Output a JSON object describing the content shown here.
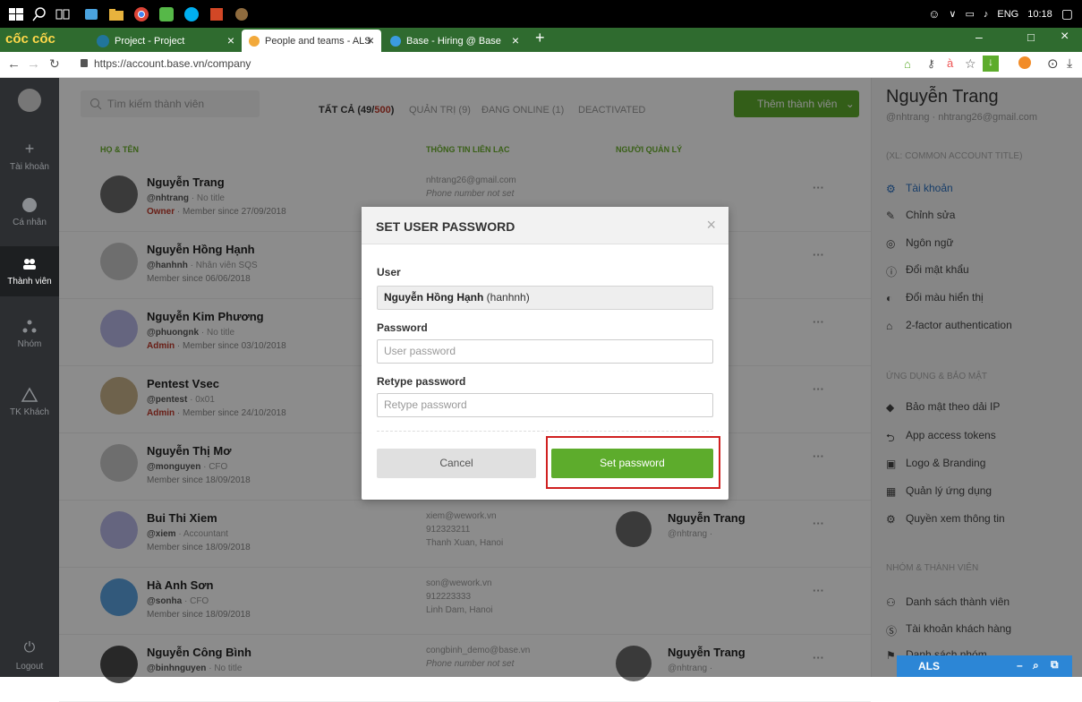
{
  "taskbar": {
    "language": "ENG",
    "time": "10:18"
  },
  "browser": {
    "brand": "cốc cốc",
    "tabs": [
      {
        "label": "Project - Project",
        "active": false
      },
      {
        "label": "People and teams - ALS",
        "active": true
      },
      {
        "label": "Base - Hiring @ Base",
        "active": false
      }
    ],
    "url": "https://account.base.vn/company"
  },
  "leftnav": {
    "items": [
      {
        "label": "Tài khoản",
        "active": false
      },
      {
        "label": "Cá nhân",
        "active": false
      },
      {
        "label": "Thành viên",
        "active": true
      },
      {
        "label": "Nhóm",
        "active": false
      },
      {
        "label": "TK Khách",
        "active": false
      }
    ],
    "logout": "Logout"
  },
  "main": {
    "search_placeholder": "Tìm kiếm thành viên",
    "filters": {
      "all_prefix": "TẤT CẢ (49/",
      "all_limit": "500",
      "all_suffix": ")",
      "admins": "QUẢN TRỊ (9)",
      "online": "ĐANG ONLINE (1)",
      "deactivated": "DEACTIVATED"
    },
    "add_button": "Thêm thành viên",
    "columns": {
      "name": "HỌ & TÊN",
      "contact": "THÔNG TIN LIÊN LẠC",
      "manager": "NGƯỜI QUẢN LÝ"
    },
    "rows": [
      {
        "name": "Nguyễn Trang",
        "handle": "@nhtrang",
        "title": "No title",
        "role": "Owner",
        "since": "Member since 27/09/2018",
        "contact1": "nhtrang26@gmail.com",
        "contact2": "Phone number not set",
        "contact3": "",
        "manager": "",
        "manager_handle": ""
      },
      {
        "name": "Nguyễn Hồng Hạnh",
        "handle": "@hanhnh",
        "title": "Nhân viên SQS",
        "role": "",
        "since": "Member since 06/06/2018",
        "contact1": "",
        "contact2": "",
        "contact3": "",
        "manager": "",
        "manager_handle": ""
      },
      {
        "name": "Nguyễn Kim Phương",
        "handle": "@phuongnk",
        "title": "No title",
        "role": "Admin",
        "since": "Member since 03/10/2018",
        "contact1": "",
        "contact2": "",
        "contact3": "",
        "manager": "",
        "manager_handle": ""
      },
      {
        "name": "Pentest Vsec",
        "handle": "@pentest",
        "title": "0x01",
        "role": "Admin",
        "since": "Member since 24/10/2018",
        "contact1": "",
        "contact2": "",
        "contact3": "",
        "manager": "",
        "manager_handle": ""
      },
      {
        "name": "Nguyễn Thị Mơ",
        "handle": "@monguyen",
        "title": "CFO",
        "role": "",
        "since": "Member since 18/09/2018",
        "contact1": "",
        "contact2": "",
        "contact3": "",
        "manager": "",
        "manager_handle": ""
      },
      {
        "name": "Bui Thi Xiem",
        "handle": "@xiem",
        "title": "Accountant",
        "role": "",
        "since": "Member since 18/09/2018",
        "contact1": "xiem@wework.vn",
        "contact2": "912323211",
        "contact3": "Thanh Xuan, Hanoi",
        "manager": "Nguyễn Trang",
        "manager_handle": "@nhtrang ·"
      },
      {
        "name": "Hà Anh Sơn",
        "handle": "@sonha",
        "title": "CFO",
        "role": "",
        "since": "Member since 18/09/2018",
        "contact1": "son@wework.vn",
        "contact2": "912223333",
        "contact3": "Linh Dam, Hanoi",
        "manager": "",
        "manager_handle": ""
      },
      {
        "name": "Nguyễn Công Bình",
        "handle": "@binhnguyen",
        "title": "No title",
        "role": "",
        "since": "",
        "contact1": "congbinh_demo@base.vn",
        "contact2": "Phone number not set",
        "contact3": "",
        "manager": "Nguyễn Trang",
        "manager_handle": "@nhtrang ·"
      }
    ],
    "more_label": "···"
  },
  "rpanel": {
    "name": "Nguyễn Trang",
    "sub": "@nhtrang · nhtrang26@gmail.com",
    "account_title": "(XL: COMMON ACCOUNT TITLE)",
    "items1": [
      "Tài khoản",
      "Chỉnh sửa",
      "Ngôn ngữ",
      "Đổi mật khẩu",
      "Đổi màu hiển thị",
      "2-factor authentication"
    ],
    "section2": "ỨNG DỤNG & BẢO MẬT",
    "items2": [
      "Bảo mật theo dải IP",
      "App access tokens",
      "Logo & Branding",
      "Quản lý ứng dụng",
      "Quyền xem thông tin"
    ],
    "section3": "NHÓM & THÀNH VIÊN",
    "items3": [
      "Danh sách thành viên",
      "Tài khoản khách hàng",
      "Danh sách nhóm"
    ]
  },
  "als_bar": "ALS",
  "modal": {
    "title": "SET USER PASSWORD",
    "user_label": "User",
    "user_name": "Nguyễn Hồng Hạnh",
    "user_handle": "(hanhnh)",
    "password_label": "Password",
    "password_placeholder": "User password",
    "retype_label": "Retype password",
    "retype_placeholder": "Retype password",
    "cancel": "Cancel",
    "submit": "Set password"
  },
  "colors": {
    "accent_green": "#5dac2c",
    "admin_red": "#c0392b",
    "highlight_red": "#d02020",
    "als_blue": "#2c86d6"
  }
}
